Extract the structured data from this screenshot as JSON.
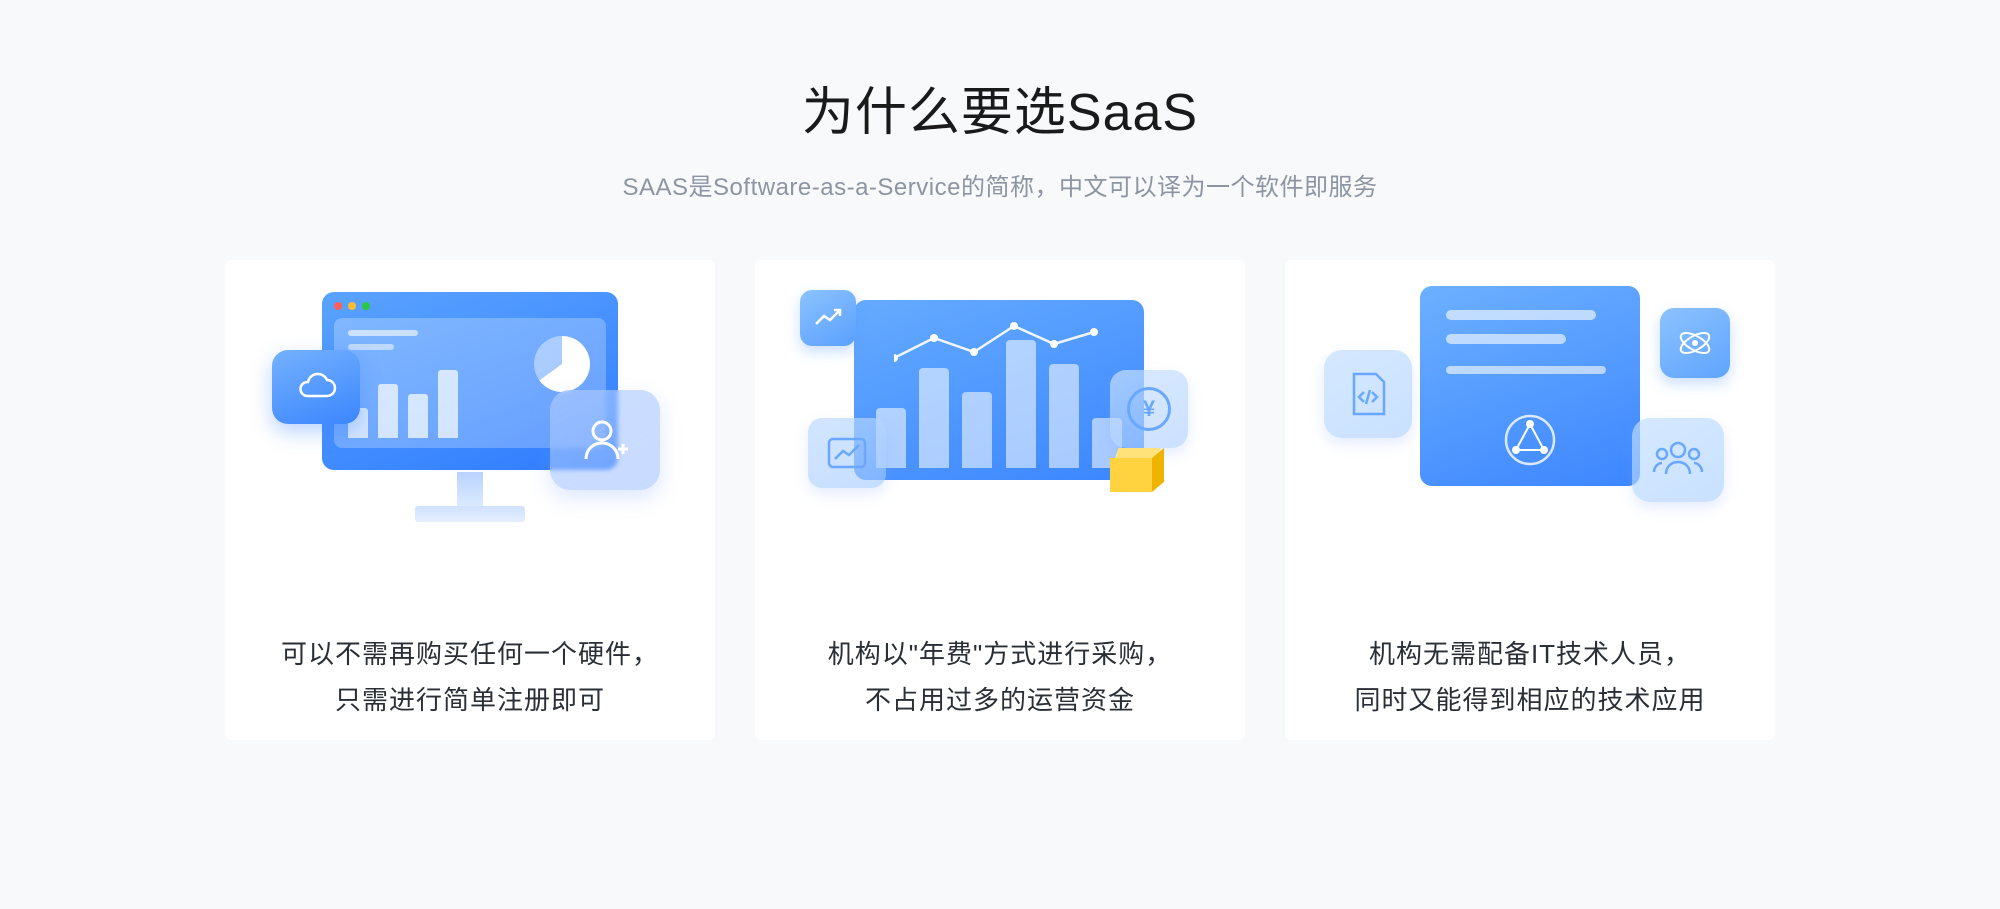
{
  "header": {
    "title": "为什么要选SaaS",
    "subtitle": "SAAS是Software-as-a-Service的简称，中文可以译为一个软件即服务"
  },
  "cards": [
    {
      "line1": "可以不需再购买任何一个硬件，",
      "line2": "只需进行简单注册即可"
    },
    {
      "line1": "机构以\"年费\"方式进行采购，",
      "line2": "不占用过多的运营资金"
    },
    {
      "line1": "机构无需配备IT技术人员，",
      "line2": "同时又能得到相应的技术应用"
    }
  ]
}
